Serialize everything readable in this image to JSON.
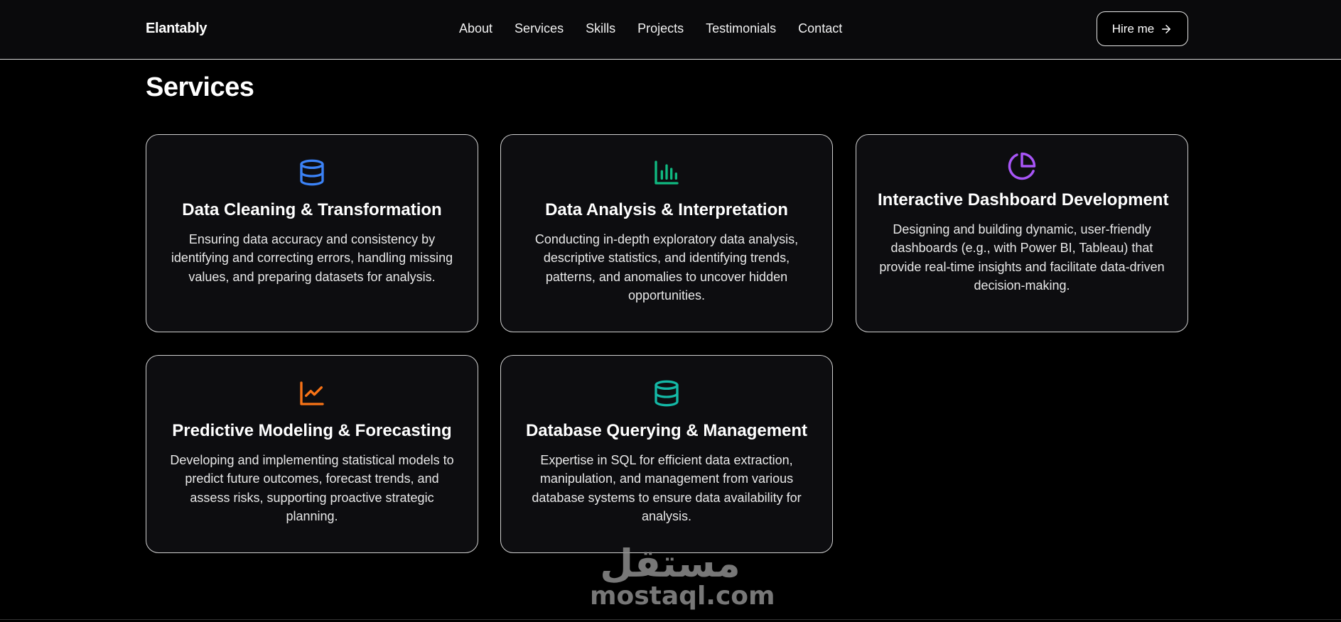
{
  "brand": "Elantably",
  "nav": {
    "items": [
      "About",
      "Services",
      "Skills",
      "Projects",
      "Testimonials",
      "Contact"
    ],
    "hire_label": "Hire me"
  },
  "section": {
    "title": "Services"
  },
  "services": [
    {
      "icon": "database-icon",
      "color": "#3b82f6",
      "title": "Data Cleaning & Transformation",
      "description": "Ensuring data accuracy and consistency by identifying and correcting errors, handling missing values, and preparing datasets for analysis."
    },
    {
      "icon": "bar-chart-icon",
      "color": "#10b981",
      "title": "Data Analysis & Interpretation",
      "description": "Conducting in-depth exploratory data analysis, descriptive statistics, and identifying trends, patterns, and anomalies to uncover hidden opportunities."
    },
    {
      "icon": "pie-chart-icon",
      "color": "#a855f7",
      "title": "Interactive Dashboard Development",
      "description": "Designing and building dynamic, user-friendly dashboards (e.g., with Power BI, Tableau) that provide real-time insights and facilitate data-driven decision-making."
    },
    {
      "icon": "line-chart-icon",
      "color": "#f97316",
      "title": "Predictive Modeling & Forecasting",
      "description": "Developing and implementing statistical models to predict future outcomes, forecast trends, and assess risks, supporting proactive strategic planning."
    },
    {
      "icon": "database-icon",
      "color": "#14b8a6",
      "title": "Database Querying & Management",
      "description": "Expertise in SQL for efficient data extraction, manipulation, and management from various database systems to ensure data availability for analysis."
    }
  ],
  "watermark": {
    "arabic": "مستقل",
    "latin": "mostaql.com"
  }
}
